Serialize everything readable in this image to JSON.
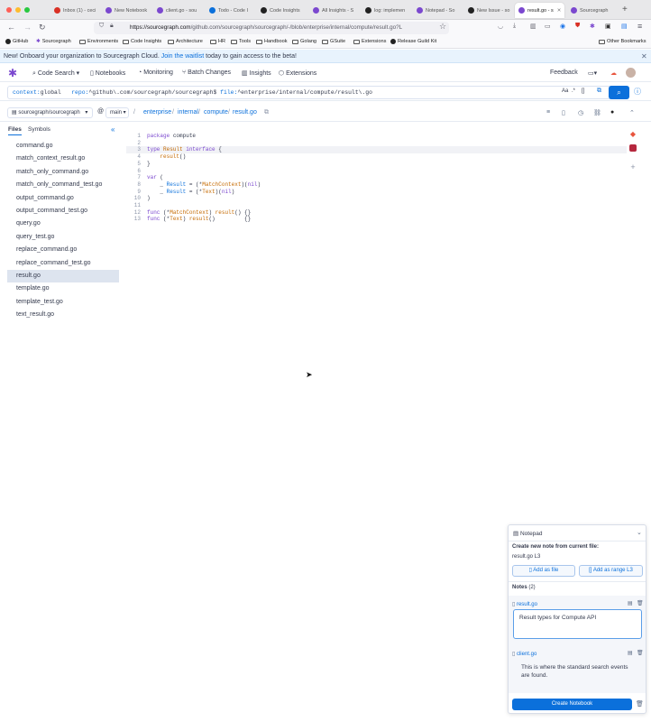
{
  "browser": {
    "tabs": [
      {
        "label": "Inbox (1) - ceci",
        "color": "#d93025"
      },
      {
        "label": "New Notebook",
        "color": "#7b48cf"
      },
      {
        "label": "client.go - sou",
        "color": "#7b48cf"
      },
      {
        "label": "Todo - Code I",
        "color": "#0b70db"
      },
      {
        "label": "Code Insights",
        "color": "#222222"
      },
      {
        "label": "All Insights - S",
        "color": "#7b48cf"
      },
      {
        "label": "log: implemen",
        "color": "#222222"
      },
      {
        "label": "Notepad - So",
        "color": "#7b48cf"
      },
      {
        "label": "New Issue - so",
        "color": "#222222"
      },
      {
        "label": "result.go - s",
        "color": "#7b48cf",
        "active": true
      },
      {
        "label": "Sourcegraph",
        "color": "#7b48cf"
      }
    ],
    "url_host": "https://sourcegraph.com",
    "url_path": "/github.com/sourcegraph/sourcegraph/-/blob/enterprise/internal/compute/result.go?L",
    "bookmarks": [
      "GitHub",
      "Sourcegraph",
      "Environments",
      "Code Insights",
      "Architecture",
      "HR",
      "Tools",
      "Handbook",
      "Golang",
      "GSuite",
      "Extensions",
      "Release Guild Kit"
    ],
    "other_bookmarks": "Other Bookmarks"
  },
  "banner": {
    "prefix": "New! Onboard your organization to Sourcegraph Cloud.",
    "link": "Join the waitlist",
    "suffix": "today to gain access to the beta!"
  },
  "nav": {
    "code_search": "Code Search",
    "notebooks": "Notebooks",
    "monitoring": "Monitoring",
    "batch_changes": "Batch Changes",
    "insights": "Insights",
    "extensions": "Extensions",
    "feedback": "Feedback"
  },
  "search": {
    "context_key": "context:",
    "context_val": "global",
    "repo_key": "repo:",
    "repo_val": "^github\\.com/sourcegraph/sourcegraph$",
    "file_key": "file:",
    "file_val": "^enterprise/internal/compute/result\\.go",
    "toggle_case": "Aa",
    "toggle_regex": ".*",
    "toggle_structural": "[]"
  },
  "repo": {
    "name": "sourcegraph/sourcegraph",
    "branch": "main",
    "at": "@",
    "path": [
      "enterprise",
      "internal",
      "compute",
      "result.go"
    ]
  },
  "sidebar": {
    "tab_files": "Files",
    "tab_symbols": "Symbols",
    "files": [
      "command.go",
      "match_context_result.go",
      "match_only_command.go",
      "match_only_command_test.go",
      "output_command.go",
      "output_command_test.go",
      "query.go",
      "query_test.go",
      "replace_command.go",
      "replace_command_test.go",
      "result.go",
      "template.go",
      "template_test.go",
      "text_result.go"
    ],
    "selected": "result.go"
  },
  "code": {
    "highlighted_line": 3,
    "lines": [
      {
        "n": "1"
      },
      {
        "n": "2"
      },
      {
        "n": "3"
      },
      {
        "n": "4"
      },
      {
        "n": "5"
      },
      {
        "n": "6"
      },
      {
        "n": "7"
      },
      {
        "n": "8"
      },
      {
        "n": "9"
      },
      {
        "n": "10"
      },
      {
        "n": "11"
      },
      {
        "n": "12"
      },
      {
        "n": "13"
      }
    ]
  },
  "notepad": {
    "title": "Notepad",
    "create_label": "Create new note from current file:",
    "current_file": "result.go L3",
    "add_file": "Add as file",
    "add_range": "Add as range L3",
    "notes_label": "Notes",
    "notes_count": "(2)",
    "notes": [
      {
        "file": "result.go",
        "text": "Result types for Compute API"
      },
      {
        "file": "client.go",
        "text": "This is where the standard search events are found."
      }
    ],
    "create_notebook": "Create Notebook"
  }
}
